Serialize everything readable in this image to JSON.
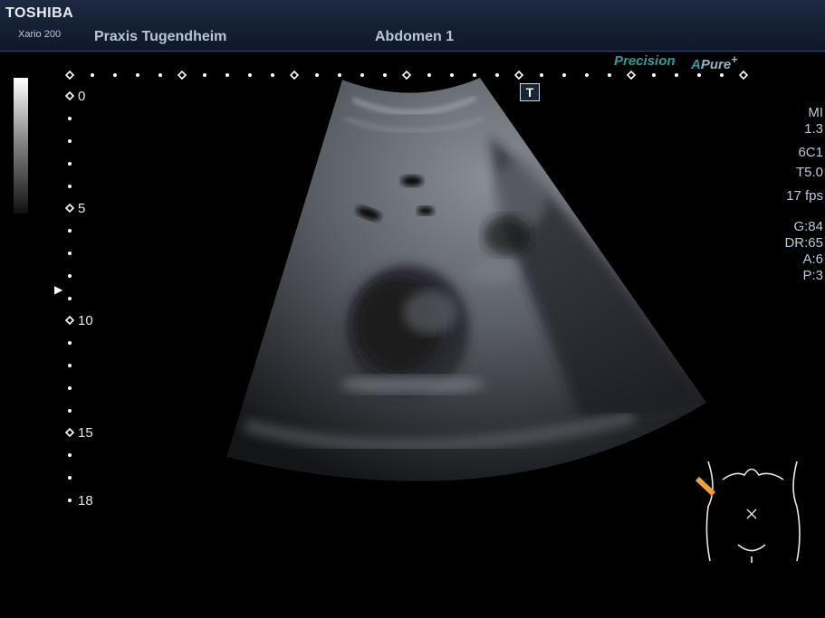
{
  "header": {
    "brand": "TOSHIBA",
    "model": "Xario 200",
    "institution": "Praxis Tugendheim",
    "preset": "Abdomen 1"
  },
  "logos": {
    "precision": "Precision",
    "apure_a": "A",
    "apure_rest": "Pure",
    "apure_plus": "+"
  },
  "badge": {
    "label": "T"
  },
  "depth_scale": {
    "labels": [
      "0",
      "5",
      "10",
      "15",
      "18"
    ]
  },
  "params": {
    "mi_label": "MI",
    "mi_value": "1.3",
    "probe": "6C1",
    "tis": "T5.0",
    "fps": "17 fps",
    "gain": "G:84",
    "dynamic_range": "DR:65",
    "a": "A:6",
    "p": "P:3"
  },
  "bodymark": {
    "probe_color": "#f0a030"
  }
}
